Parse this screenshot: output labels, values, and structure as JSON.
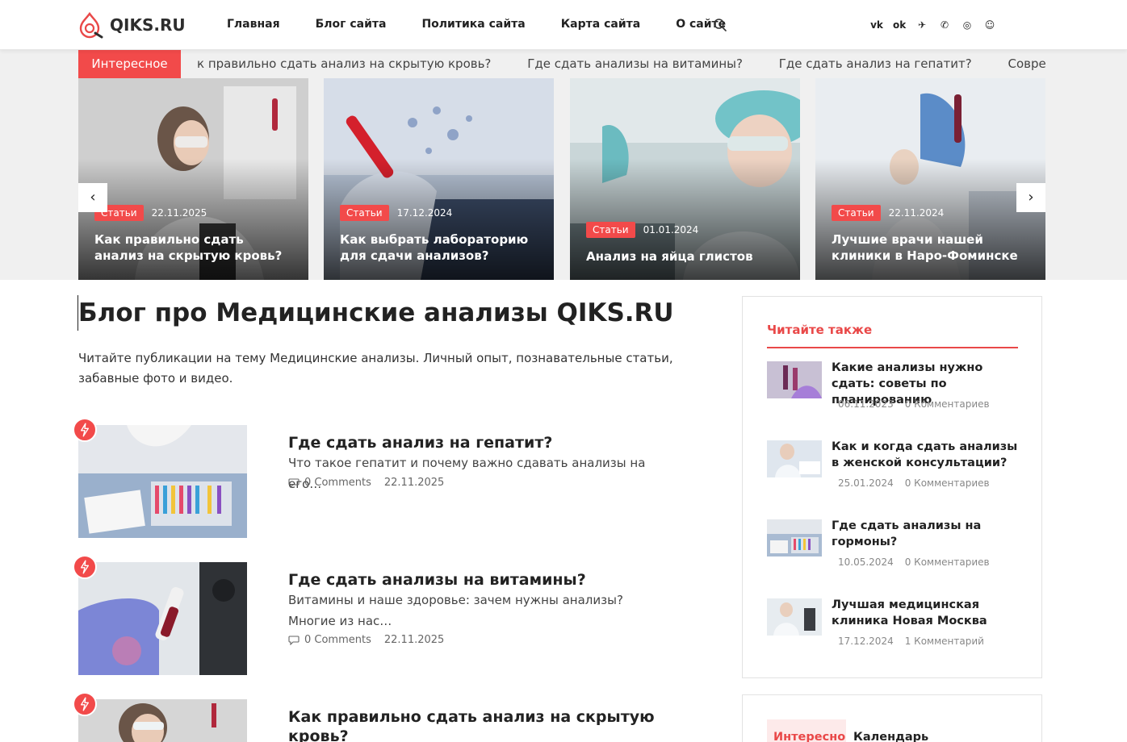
{
  "header": {
    "logo_text": "QIKS.RU",
    "nav": [
      "Главная",
      "Блог сайта",
      "Политика сайта",
      "Карта сайта",
      "О сайте"
    ],
    "socials": [
      "vk-icon",
      "odnoklassniki-icon",
      "telegram-icon",
      "viber-icon",
      "whatsapp-icon",
      "yandex-zen-icon"
    ],
    "social_glyphs": [
      "vk",
      "ok",
      "✈",
      "✆",
      "◎",
      "☺"
    ]
  },
  "ticker": {
    "label": "Интересное",
    "items": [
      "к правильно сдать анализ на скрытую кровь?",
      "Где сдать анализы на витамины?",
      "Где сдать анализ на гепатит?",
      "Современный подх"
    ]
  },
  "slider": {
    "prev": "‹",
    "next": "›",
    "slides": [
      {
        "badge": "Статьи",
        "date": "22.11.2025",
        "title": "Как правильно сдать анализ на скрытую кровь?"
      },
      {
        "badge": "Статьи",
        "date": "17.12.2024",
        "title": "Как выбрать лабораторию для сдачи анализов?"
      },
      {
        "badge": "Статьи",
        "date": "01.01.2024",
        "title": "Анализ на яйца глистов"
      },
      {
        "badge": "Статьи",
        "date": "22.11.2024",
        "title": "Лучшие врачи нашей клиники в Наро-Фоминске"
      }
    ]
  },
  "main": {
    "title": "Блог про Медицинские анализы QIKS.RU",
    "intro": "Читайте публикации на тему Медицинские анализы. Личный опыт, познавательные статьи, забавные фото и видео.",
    "posts": [
      {
        "title": "Где сдать анализ на гепатит?",
        "excerpt": "Что такое гепатит и почему важно сдавать анализы на его…",
        "comments": "0 Comments",
        "date": "22.11.2025"
      },
      {
        "title": "Где сдать анализы на витамины?",
        "excerpt": "Витамины и наше здоровье: зачем нужны анализы? Многие из нас…",
        "comments": "0 Comments",
        "date": "22.11.2025"
      },
      {
        "title": "Как правильно сдать анализ на скрытую кровь?",
        "excerpt": "",
        "comments": "",
        "date": ""
      }
    ]
  },
  "sidebar": {
    "title": "Читайте также",
    "items": [
      {
        "title": "Какие анализы нужно сдать: советы по планированию",
        "date": "06.11.2023",
        "comments": "0 Комментариев"
      },
      {
        "title": "Как и когда сдать анализы в женской консультации?",
        "date": "25.01.2024",
        "comments": "0 Комментариев"
      },
      {
        "title": "Где сдать анализы на гормоны?",
        "date": "10.05.2024",
        "comments": "0 Комментариев"
      },
      {
        "title": "Лучшая медицинская клиника Новая Москва",
        "date": "17.12.2024",
        "comments": "1 Комментарий"
      }
    ],
    "tabs": [
      "Интересно",
      "Календарь"
    ]
  },
  "colors": {
    "accent": "#f24a4a",
    "text": "#222222"
  }
}
